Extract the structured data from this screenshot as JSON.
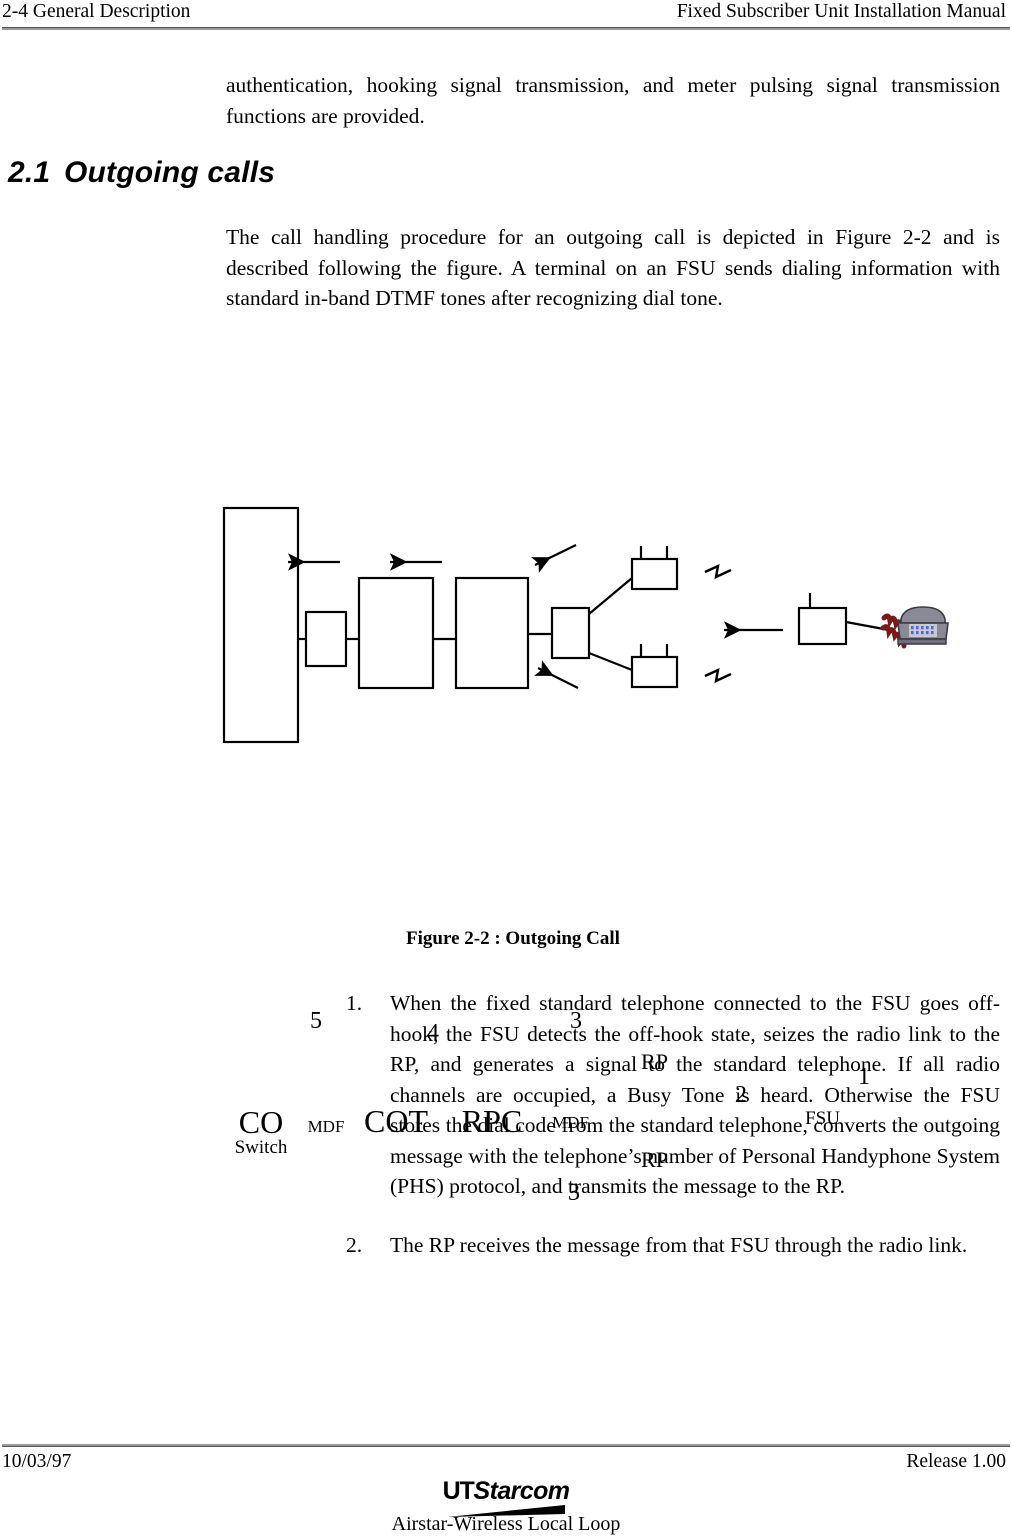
{
  "header": {
    "left": "2-4  General Description",
    "right": "Fixed Subscriber Unit Installation Manual"
  },
  "body": {
    "continued_paragraph": "authentication, hooking signal transmission, and meter pulsing signal transmission functions are provided.",
    "section": {
      "number": "2.1",
      "title": "Outgoing calls"
    },
    "intro_paragraph": "The call handling procedure for an outgoing call is depicted in Figure 2-2 and is described following the figure.  A terminal on an FSU sends dialing information with standard in-band DTMF tones after recognizing dial tone."
  },
  "figure": {
    "caption": "Figure 2-2 : Outgoing Call",
    "nodes": {
      "co_switch_line1": "CO",
      "co_switch_line2": "Switch",
      "mdf_left": "MDF",
      "cot": "COT",
      "rpc": "RPC",
      "mdf_right": "MDF",
      "rp_top": "RP",
      "rp_bottom": "RP",
      "fsu": "FSU"
    },
    "step_labels": {
      "five": "5",
      "four": "4",
      "three_top": "3",
      "three_bottom": "3",
      "two": "2",
      "one": "1"
    }
  },
  "list": {
    "items": [
      {
        "marker": "1.",
        "text": "When the fixed standard telephone connected to the FSU goes off-hook, the FSU detects the off-hook state, seizes the radio link to the RP, and generates a signal to the standard telephone. If all radio channels are occupied, a Busy Tone is heard. Otherwise the FSU stores the dial code from the standard telephone, converts the outgoing message with the telephone’s number of Personal Handyphone System (PHS) protocol, and transmits the message to the RP."
      },
      {
        "marker": "2.",
        "text": "The RP receives the message from that FSU through the radio link."
      }
    ]
  },
  "footer": {
    "date": "10/03/97",
    "release": "Release 1.00",
    "logo_prefix": "UT",
    "logo_suffix": "Starcom",
    "tagline": "Airstar-Wireless Local Loop"
  },
  "colors": {
    "text": "#000000",
    "rule": "#9a9a9a",
    "phone_body": "#8a8a96",
    "phone_dark": "#4a4a55",
    "phone_keypad": "#5566dd",
    "phone_cord": "#7a1a1a"
  }
}
